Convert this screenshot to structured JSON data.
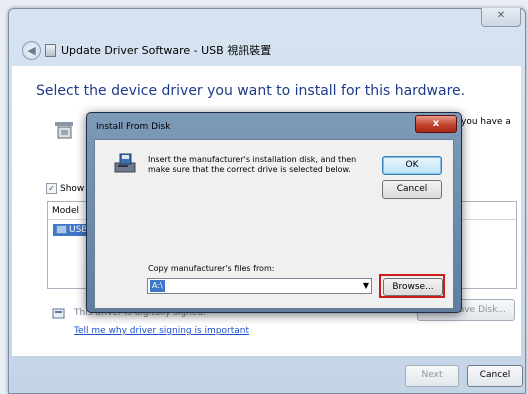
{
  "window": {
    "title": "Update Driver Software - USB 視訊裝置",
    "close_glyph": "✕"
  },
  "main": {
    "heading": "Select the device driver you want to install for this hardware.",
    "partial_right_text": "you have a",
    "show_compatible_label": "Show",
    "list": {
      "column_header": "Model",
      "selected_item": "USB"
    },
    "unsigned_notice": "This driver is digitally signed.",
    "have_disk_label": "Have Disk...",
    "link_text": "Tell me why driver signing is important",
    "next_label": "Next",
    "cancel_label": "Cancel"
  },
  "dialog": {
    "title": "Install From Disk",
    "close_glyph": "x",
    "instructions": "Insert the manufacturer's installation disk, and then make sure that the correct drive is selected below.",
    "ok_label": "OK",
    "cancel_label": "Cancel",
    "copy_label": "Copy manufacturer's files from:",
    "path_value": "A:\\",
    "browse_label": "Browse..."
  },
  "icons": {
    "back": "back-arrow-icon",
    "dropdown": "chevron-down-icon"
  },
  "colors": {
    "heading": "#1e3a8a",
    "selection": "#3d77c9",
    "highlight_box": "#cc1b1b",
    "link": "#1c4fd1"
  }
}
